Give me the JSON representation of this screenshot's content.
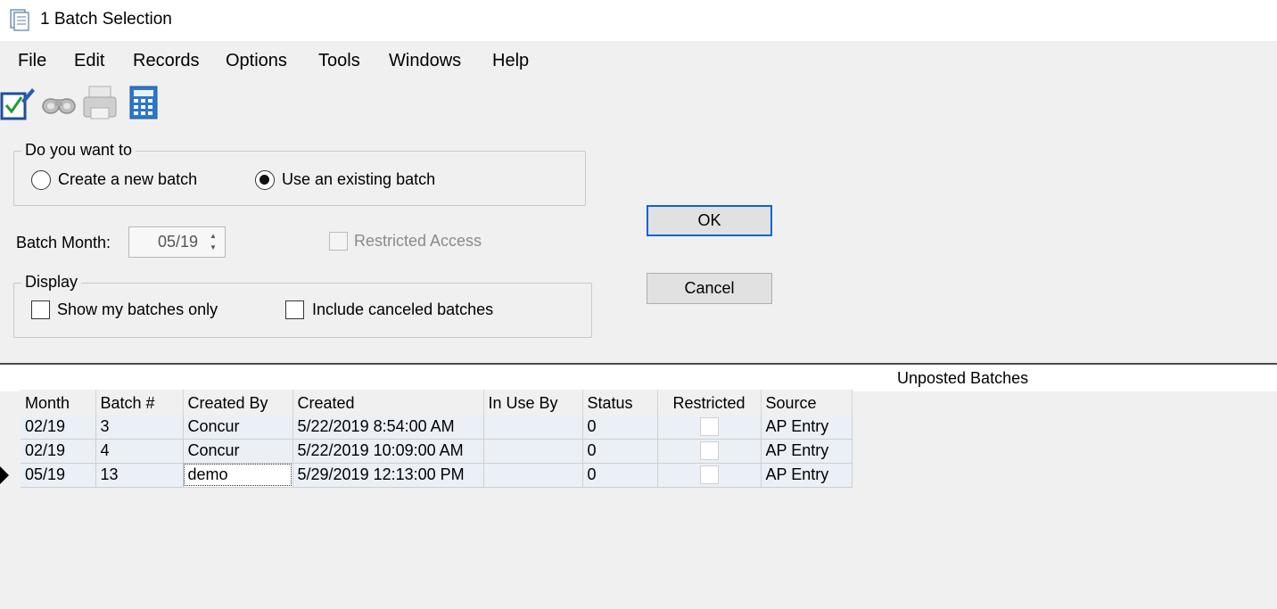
{
  "window": {
    "title": "1 Batch Selection"
  },
  "menu": {
    "items": [
      "File",
      "Edit",
      "Records",
      "Options",
      "Tools",
      "Windows",
      "Help"
    ]
  },
  "toolbar": {
    "icons": [
      "checklist-icon",
      "binoculars-icon",
      "printer-icon",
      "calculator-icon"
    ]
  },
  "batch_choice": {
    "legend": "Do you want to",
    "options": [
      {
        "label": "Create a new batch",
        "selected": false
      },
      {
        "label": "Use an existing batch",
        "selected": true
      }
    ]
  },
  "batch_month": {
    "label": "Batch Month:",
    "value": "05/19"
  },
  "restricted_access": {
    "label": "Restricted Access",
    "checked": false,
    "enabled": false
  },
  "display": {
    "legend": "Display",
    "options": [
      {
        "label": "Show my batches only",
        "checked": false
      },
      {
        "label": "Include canceled batches",
        "checked": false
      }
    ]
  },
  "buttons": {
    "ok": "OK",
    "cancel": "Cancel"
  },
  "batches": {
    "title": "Unposted Batches",
    "columns": [
      "Month",
      "Batch #",
      "Created By",
      "Created",
      "In Use By",
      "Status",
      "Restricted",
      "Source"
    ],
    "rows": [
      {
        "month": "02/19",
        "batch": "3",
        "created_by": "Concur",
        "created": "5/22/2019 8:54:00 AM",
        "in_use_by": "",
        "status": "0",
        "restricted": false,
        "source": "AP Entry"
      },
      {
        "month": "02/19",
        "batch": "4",
        "created_by": "Concur",
        "created": "5/22/2019 10:09:00 AM",
        "in_use_by": "",
        "status": "0",
        "restricted": false,
        "source": "AP Entry"
      },
      {
        "month": "05/19",
        "batch": "13",
        "created_by": "demo",
        "created": "5/29/2019 12:13:00 PM",
        "in_use_by": "",
        "status": "0",
        "restricted": false,
        "source": "AP Entry"
      }
    ],
    "selected_row": 2
  }
}
